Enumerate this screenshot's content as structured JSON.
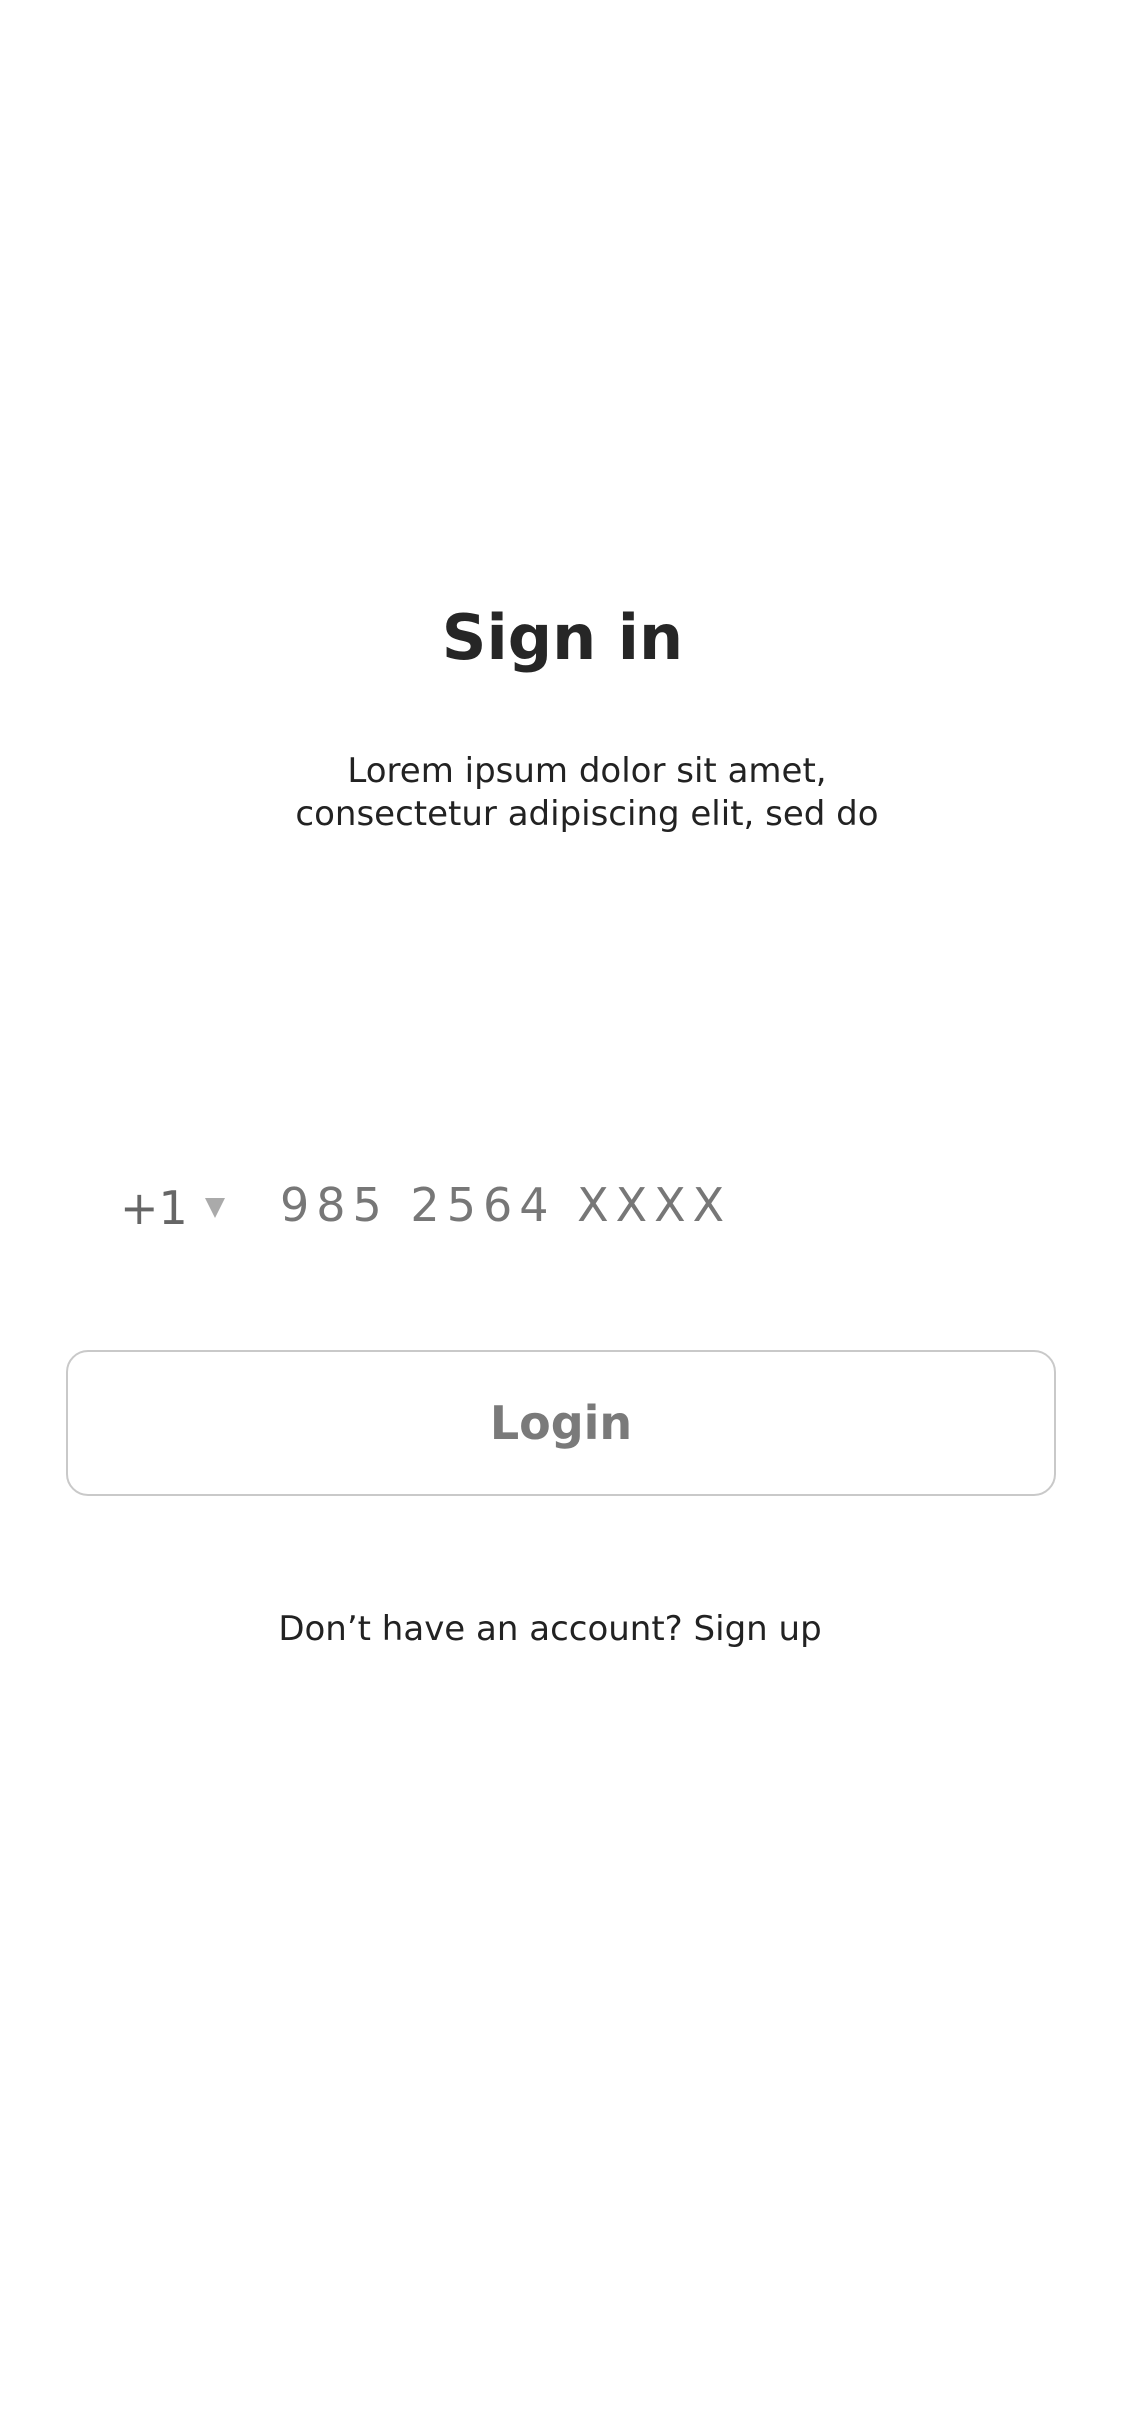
{
  "screen": {
    "title": "Sign in",
    "description_lines": [
      "Lorem ipsum dolor sit amet,",
      "consectetur adipiscing elit, sed do"
    ]
  },
  "phone": {
    "country_code": "+1",
    "dropdown_icon": "triangle-down-icon",
    "placeholder": "985 2564 XXXX",
    "value": ""
  },
  "actions": {
    "login_label": "Login",
    "signup_prompt": "Don’t have an account?",
    "signup_link": "Sign up"
  },
  "colors": {
    "background": "#ffffff",
    "title": "#262626",
    "muted_text": "#777777",
    "button_border": "#c9c9c9",
    "caret": "#aaaaaa"
  }
}
